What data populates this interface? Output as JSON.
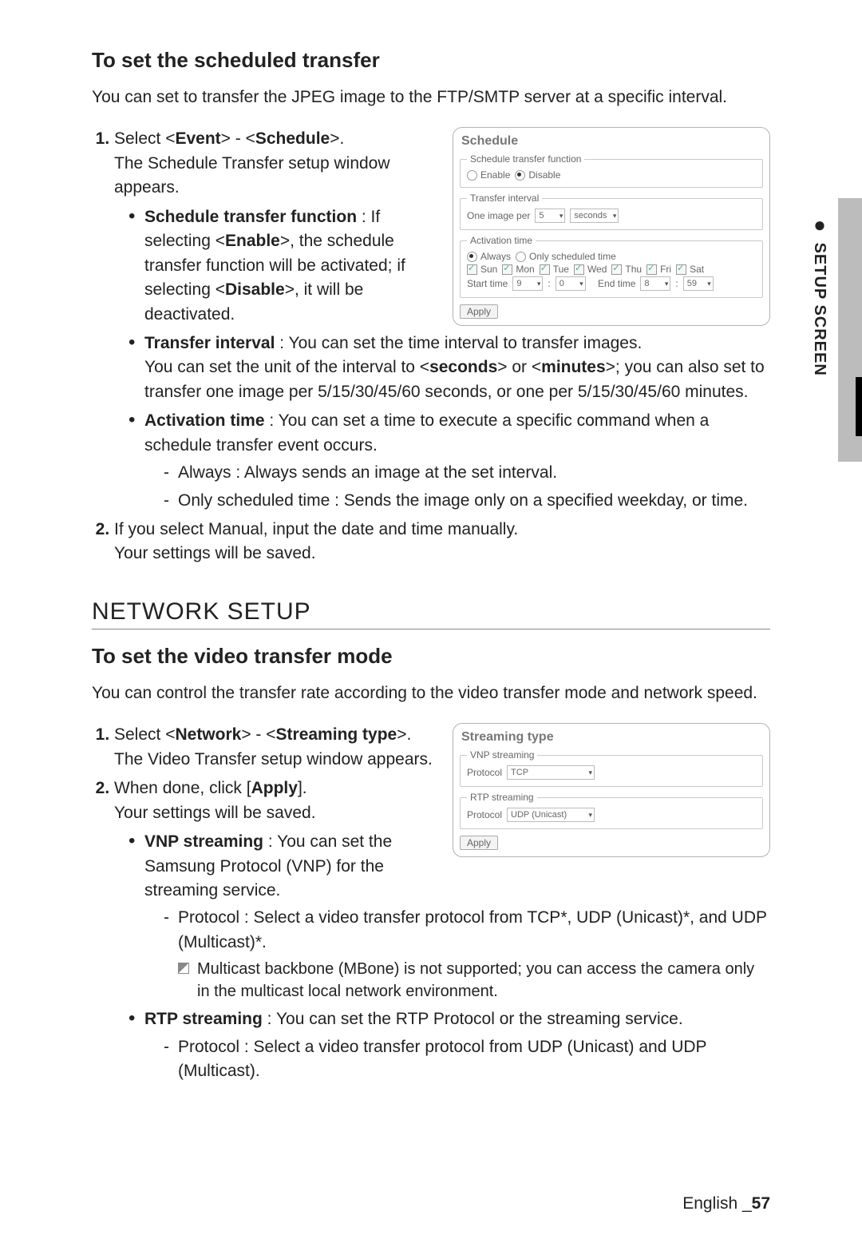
{
  "sideTab": {
    "dot": "●",
    "label": "SETUP SCREEN"
  },
  "section1": {
    "heading": "To set the scheduled transfer",
    "intro": "You can set to transfer the JPEG image to the FTP/SMTP server at a specific interval.",
    "step1_a": "Select <",
    "step1_b1": "Event",
    "step1_c": "> - <",
    "step1_b2": "Schedule",
    "step1_d": ">.",
    "step1_rest": "The Schedule Transfer setup window appears.",
    "b1_title": "Schedule transfer function",
    "b1_body_a": " : If selecting <",
    "b1_body_b1": "Enable",
    "b1_body_c": ">, the schedule transfer function will be activated; if selecting <",
    "b1_body_b2": "Disable",
    "b1_body_d": ">, it will be deactivated.",
    "b2_title": "Transfer interval",
    "b2_body_a": " : You can set the time interval to transfer images.",
    "b2_body_full_a": "You can set the unit of the interval to <",
    "b2_body_full_b1": "seconds",
    "b2_body_full_c": "> or <",
    "b2_body_full_b2": "minutes",
    "b2_body_full_d": ">; you can also set to transfer one image per 5/15/30/45/60 seconds, or one per 5/15/30/45/60 minutes.",
    "b3_title": "Activation time",
    "b3_body": " : You can set a time to execute a specific command when a schedule transfer event occurs.",
    "b3_d1": "Always : Always sends an image at the set interval.",
    "b3_d2": "Only scheduled time : Sends the image only on a specified weekday, or time.",
    "step2_a": "If you select Manual, input the date and time manually.",
    "step2_b": "Your settings will be saved."
  },
  "panel1": {
    "title": "Schedule",
    "fs1": "Schedule transfer function",
    "enable": "Enable",
    "disable": "Disable",
    "fs2": "Transfer interval",
    "interval_lead": "One image per",
    "interval_val": "5",
    "interval_unit": "seconds",
    "fs3": "Activation time",
    "always": "Always",
    "scheduled": "Only scheduled time",
    "days": [
      "Sun",
      "Mon",
      "Tue",
      "Wed",
      "Thu",
      "Fri",
      "Sat"
    ],
    "start": "Start time",
    "end": "End time",
    "sh": "9",
    "sm": "0",
    "eh": "8",
    "em": "59",
    "apply": "Apply"
  },
  "sectionH": {
    "heading": "Network Setup"
  },
  "section2": {
    "heading": "To set the video transfer mode",
    "intro": "You can control the transfer rate according to the video transfer mode and network speed.",
    "step1_a": "Select <",
    "step1_b1": "Network",
    "step1_c": "> - <",
    "step1_b2": "Streaming type",
    "step1_d": ">.",
    "step1_rest": "The Video Transfer setup window appears.",
    "step2_a": "When done, click [",
    "step2_b": "Apply",
    "step2_c": "].",
    "step2_rest": "Your settings will be saved.",
    "b1_title": "VNP streaming",
    "b1_body": " : You can set the Samsung Protocol (VNP) for the streaming service.",
    "b1_d1": "Protocol : Select a video transfer protocol from TCP*, UDP (Unicast)*, and UDP (Multicast)*.",
    "b1_note": "Multicast backbone (MBone) is not supported; you can access the camera only in the multicast local network environment.",
    "b2_title": "RTP streaming",
    "b2_body": " : You can set the RTP Protocol or the streaming service.",
    "b2_d1": "Protocol : Select a video transfer protocol from UDP (Unicast) and UDP (Multicast)."
  },
  "panel2": {
    "title": "Streaming type",
    "fs1": "VNP streaming",
    "p1lbl": "Protocol",
    "p1val": "TCP",
    "fs2": "RTP streaming",
    "p2lbl": "Protocol",
    "p2val": "UDP (Unicast)",
    "apply": "Apply"
  },
  "footer": {
    "lang": "English _",
    "page": "57"
  }
}
